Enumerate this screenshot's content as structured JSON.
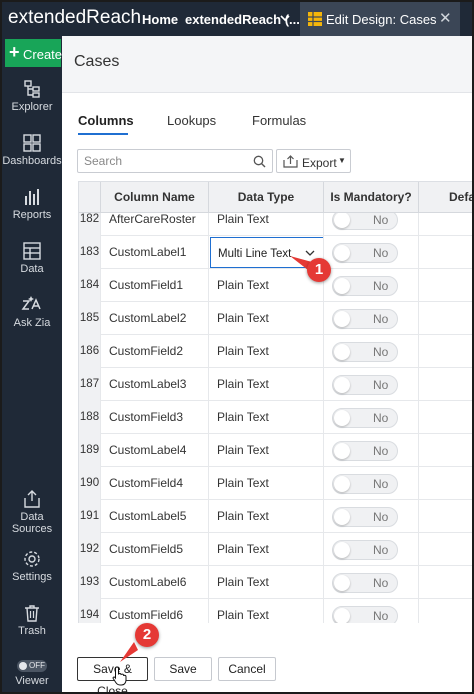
{
  "topbar": {
    "app_name": "extendedReach",
    "home_tab": "Home",
    "workspace_tab": "extendedReach (...",
    "active_tab": "Edit Design: Cases"
  },
  "sidebar": {
    "create_label": "Create",
    "items": [
      {
        "label": "Explorer",
        "icon": "explorer-icon"
      },
      {
        "label": "Dashboards",
        "icon": "dashboards-icon"
      },
      {
        "label": "Reports",
        "icon": "reports-icon"
      },
      {
        "label": "Data",
        "icon": "data-icon"
      },
      {
        "label": "Ask Zia",
        "icon": "ask-zia-icon"
      },
      {
        "label": "Data Sources",
        "label_line1": "Data",
        "label_line2": "Sources",
        "icon": "data-sources-icon"
      },
      {
        "label": "Settings",
        "icon": "settings-icon"
      },
      {
        "label": "Trash",
        "icon": "trash-icon"
      },
      {
        "label": "Viewer",
        "icon": "viewer-toggle-icon",
        "toggle_text": "OFF"
      }
    ]
  },
  "page": {
    "title": "Cases",
    "tabs": [
      "Columns",
      "Lookups",
      "Formulas"
    ],
    "active_tab": "Columns",
    "search_placeholder": "Search",
    "export_label": "Export"
  },
  "table": {
    "headers": [
      "",
      "Column Name",
      "Data Type",
      "Is Mandatory?",
      "Defa"
    ],
    "rows": [
      {
        "num": "182",
        "name": "AfterCareRoster",
        "type": "Plain Text",
        "mandatory": "No"
      },
      {
        "num": "183",
        "name": "CustomLabel1",
        "type": "Multi Line Text",
        "mandatory": "No",
        "editing": true
      },
      {
        "num": "184",
        "name": "CustomField1",
        "type": "Plain Text",
        "mandatory": "No"
      },
      {
        "num": "185",
        "name": "CustomLabel2",
        "type": "Plain Text",
        "mandatory": "No"
      },
      {
        "num": "186",
        "name": "CustomField2",
        "type": "Plain Text",
        "mandatory": "No"
      },
      {
        "num": "187",
        "name": "CustomLabel3",
        "type": "Plain Text",
        "mandatory": "No"
      },
      {
        "num": "188",
        "name": "CustomField3",
        "type": "Plain Text",
        "mandatory": "No"
      },
      {
        "num": "189",
        "name": "CustomLabel4",
        "type": "Plain Text",
        "mandatory": "No"
      },
      {
        "num": "190",
        "name": "CustomField4",
        "type": "Plain Text",
        "mandatory": "No"
      },
      {
        "num": "191",
        "name": "CustomLabel5",
        "type": "Plain Text",
        "mandatory": "No"
      },
      {
        "num": "192",
        "name": "CustomField5",
        "type": "Plain Text",
        "mandatory": "No"
      },
      {
        "num": "193",
        "name": "CustomLabel6",
        "type": "Plain Text",
        "mandatory": "No"
      },
      {
        "num": "194",
        "name": "CustomField6",
        "type": "Plain Text",
        "mandatory": "No"
      }
    ]
  },
  "footer": {
    "save_close_label": "Save & Close",
    "save_label": "Save",
    "cancel_label": "Cancel"
  },
  "callouts": [
    "1",
    "2"
  ],
  "colors": {
    "sidebar_bg": "#1f2937",
    "create_green": "#18a558",
    "accent_blue": "#1f6fd1",
    "callout_red": "#e53935"
  }
}
